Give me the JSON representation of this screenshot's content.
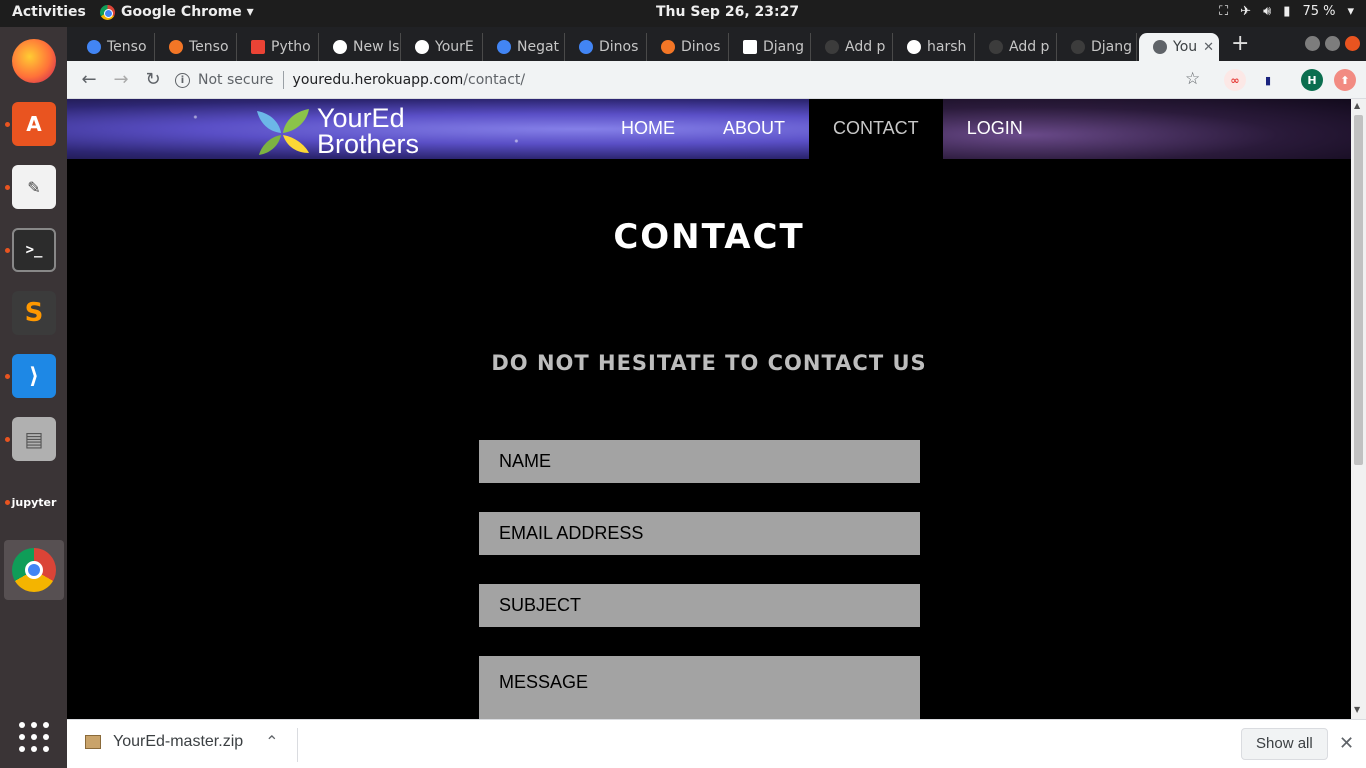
{
  "desktop": {
    "activities": "Activities",
    "app_menu": "Google Chrome ▾",
    "clock": "Thu Sep 26, 23:27",
    "battery": "75 %"
  },
  "dock": [
    {
      "name": "firefox",
      "icon": "firefox-icon",
      "color": "#ff7139"
    },
    {
      "name": "software",
      "icon": "software-center-icon",
      "color": "#e95420"
    },
    {
      "name": "text-editor",
      "icon": "text-editor-icon",
      "color": "#f2f2f2"
    },
    {
      "name": "terminal",
      "icon": "terminal-icon",
      "color": "#2c2c2c"
    },
    {
      "name": "sublime",
      "icon": "sublime-text-icon",
      "color": "#ff9800"
    },
    {
      "name": "vscode",
      "icon": "vscode-icon",
      "color": "#1e88e5"
    },
    {
      "name": "files",
      "icon": "file-cabinet-icon",
      "color": "#9e9e9e"
    },
    {
      "name": "jupyter",
      "icon": "jupyter-icon",
      "color": "#f37626",
      "label": "jupyter"
    },
    {
      "name": "chrome",
      "icon": "chrome-icon",
      "color": "#4285f4"
    }
  ],
  "tabs": [
    {
      "label": "Tenso",
      "icon_color": "#4285f4"
    },
    {
      "label": "Tenso",
      "icon_color": "#f37626"
    },
    {
      "label": "Pytho",
      "icon_color": "#ea4335"
    },
    {
      "label": "New Is",
      "icon_color": "#ffffff"
    },
    {
      "label": "YourE",
      "icon_color": "#ffffff"
    },
    {
      "label": "Negat",
      "icon_color": "#4285f4"
    },
    {
      "label": "Dinos",
      "icon_color": "#4285f4"
    },
    {
      "label": "Dinos",
      "icon_color": "#f37626"
    },
    {
      "label": "Djang",
      "icon_color": "#ffffff"
    },
    {
      "label": "Add p",
      "icon_color": "#3c3c3c"
    },
    {
      "label": "harsh",
      "icon_color": "#ffffff"
    },
    {
      "label": "Add p",
      "icon_color": "#3c3c3c"
    },
    {
      "label": "Djang",
      "icon_color": "#3c3c3c"
    },
    {
      "label": "You",
      "icon_color": "#5f6368",
      "active": true
    }
  ],
  "address": {
    "security": "Not secure",
    "host": "youredu.herokuapp.com",
    "path": "/contact/"
  },
  "extensions": [
    {
      "label": "∞",
      "color": "#e53935"
    },
    {
      "label": "▮",
      "color": "#ffffff"
    },
    {
      "label": "H",
      "color": "#0b6e4f"
    },
    {
      "label": "⬆",
      "color": "#f28b82"
    }
  ],
  "site": {
    "logo_line1": "YourEd",
    "logo_line2": "Brothers",
    "nav": [
      "HOME",
      "ABOUT",
      "CONTACT",
      "LOGIN"
    ],
    "current_nav": "CONTACT",
    "title": "CONTACT",
    "subtitle": "DO NOT HESITATE TO CONTACT US",
    "form": {
      "name_placeholder": "NAME",
      "email_placeholder": "EMAIL ADDRESS",
      "subject_placeholder": "SUBJECT",
      "message_placeholder": "MESSAGE"
    }
  },
  "downloads": {
    "file": "YourEd-master.zip",
    "show_all": "Show all"
  }
}
